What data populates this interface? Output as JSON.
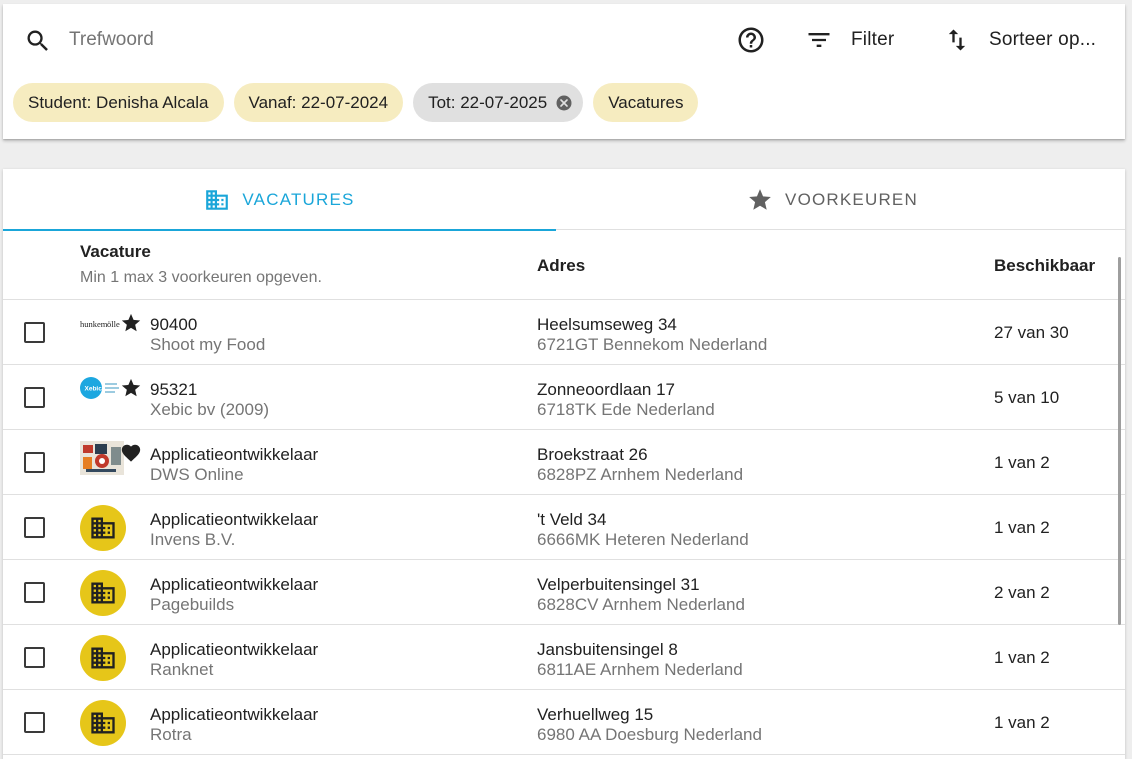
{
  "search": {
    "placeholder": "Trefwoord"
  },
  "toolbar": {
    "help_icon": "help-circle-icon",
    "filter_label": "Filter",
    "sort_label": "Sorteer op..."
  },
  "chips": [
    {
      "label": "Student: Denisha Alcala"
    },
    {
      "label": "Vanaf: 22-07-2024"
    },
    {
      "label": "Tot: 22-07-2025"
    },
    {
      "label": "Vacatures"
    }
  ],
  "tabs": [
    {
      "label": "VACATURES",
      "icon": "building-icon",
      "selected": true
    },
    {
      "label": "VOORKEUREN",
      "icon": "star-icon",
      "selected": false
    }
  ],
  "table": {
    "headers": {
      "vacature": "Vacature",
      "vacature_hint": "Min 1 max 3 voorkeuren opgeven.",
      "adres": "Adres",
      "beschikbaar": "Beschikbaar"
    },
    "rows": [
      {
        "title": "90400",
        "company": "Shoot my Food",
        "street": "Heelsumseweg 34",
        "city": "6721GT Bennekom Nederland",
        "available": "27 van 30",
        "logo": "hunkemoller-logo",
        "mark": "star-icon"
      },
      {
        "title": "95321",
        "company": "Xebic bv (2009)",
        "street": "Zonneoordlaan 17",
        "city": "6718TK Ede Nederland",
        "available": "5 van 10",
        "logo": "xebic-logo",
        "mark": "star-icon"
      },
      {
        "title": "Applicatieontwikkelaar",
        "company": "DWS Online",
        "street": "Broekstraat 26",
        "city": "6828PZ Arnhem Nederland",
        "available": "1 van 2",
        "logo": "dws-logo",
        "mark": "heart-icon"
      },
      {
        "title": "Applicatieontwikkelaar",
        "company": "Invens B.V.",
        "street": "'t Veld 34",
        "city": "6666MK Heteren Nederland",
        "available": "1 van 2",
        "logo": "building-avatar"
      },
      {
        "title": "Applicatieontwikkelaar",
        "company": "Pagebuilds",
        "street": "Velperbuitensingel 31",
        "city": "6828CV Arnhem Nederland",
        "available": "2 van 2",
        "logo": "building-avatar"
      },
      {
        "title": "Applicatieontwikkelaar",
        "company": "Ranknet",
        "street": "Jansbuitensingel 8",
        "city": "6811AE Arnhem Nederland",
        "available": "1 van 2",
        "logo": "building-avatar"
      },
      {
        "title": "Applicatieontwikkelaar",
        "company": "Rotra",
        "street": "Verhuellweg 15",
        "city": "6980 AA Doesburg Nederland",
        "available": "1 van 2",
        "logo": "building-avatar"
      }
    ]
  },
  "colors": {
    "accent": "#1aa6d9",
    "chip": "#f6ecc0",
    "chip_active": "#e0e0e0",
    "avatar": "#e6c619"
  }
}
